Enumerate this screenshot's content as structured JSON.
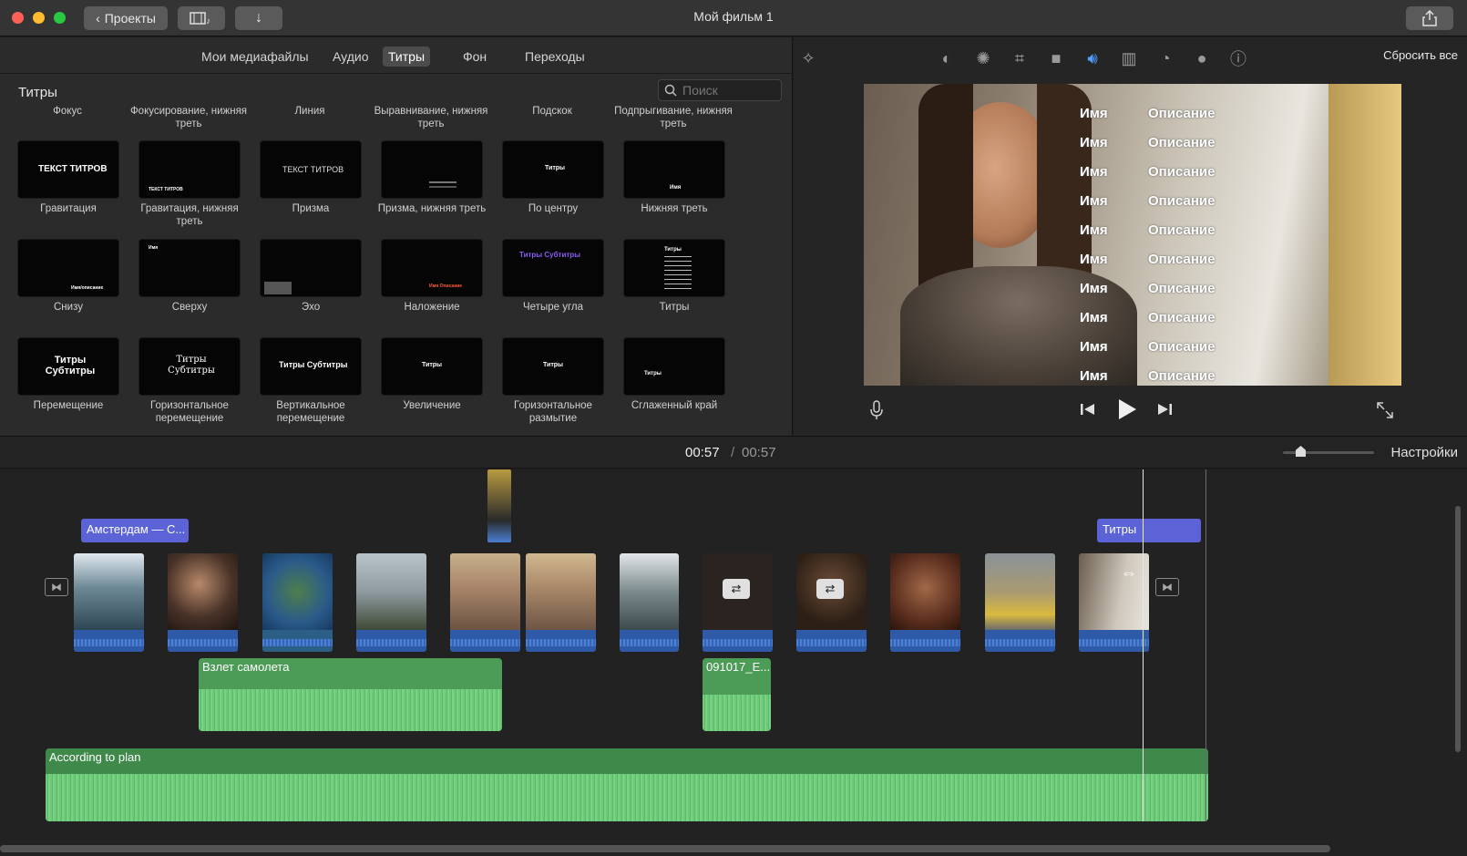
{
  "window": {
    "title": "Мой фильм 1",
    "back_label": "Проекты",
    "traffic_colors": [
      "#fe5f57",
      "#febc2e",
      "#28c840"
    ]
  },
  "browser": {
    "tabs": [
      {
        "label": "Мои медиафайлы",
        "active": false
      },
      {
        "label": "Аудио",
        "active": false
      },
      {
        "label": "Титры",
        "active": true
      },
      {
        "label": "Фон",
        "active": false
      },
      {
        "label": "Переходы",
        "active": false
      }
    ],
    "section_title": "Титры",
    "search_placeholder": "Поиск",
    "cut_labels": [
      "Фокус",
      "Фокусирование, нижняя треть",
      "Линия",
      "Выравнивание, нижняя треть",
      "Подскок",
      "Подпрыгивание, нижняя треть"
    ],
    "rows": [
      [
        {
          "label": "Гравитация",
          "thumb": "ТЕКСТ ТИТРОВ"
        },
        {
          "label": "Гравитация, нижняя треть",
          "thumb": "ТЕКСТ ТИТРОВ"
        },
        {
          "label": "Призма",
          "thumb": "ТЕКСТ ТИТРОВ"
        },
        {
          "label": "Призма, нижняя треть",
          "thumb": ""
        },
        {
          "label": "По центру",
          "thumb": "Титры"
        },
        {
          "label": "Нижняя треть",
          "thumb": "Имя"
        }
      ],
      [
        {
          "label": "Снизу",
          "thumb": "Имя/описание"
        },
        {
          "label": "Сверху",
          "thumb": "Имя"
        },
        {
          "label": "Эхо",
          "thumb": ""
        },
        {
          "label": "Наложение",
          "thumb": "Имя Описание"
        },
        {
          "label": "Четыре угла",
          "thumb": "Титры Субтитры"
        },
        {
          "label": "Титры",
          "thumb": "Титры"
        }
      ],
      [
        {
          "label": "Перемещение",
          "thumb": "Титры Субтитры"
        },
        {
          "label": "Горизонтальное перемещение",
          "thumb": "Титры Субтитры"
        },
        {
          "label": "Вертикальное перемещение",
          "thumb": "Титры Субтитры"
        },
        {
          "label": "Увеличение",
          "thumb": "Титры"
        },
        {
          "label": "Горизонтальное размытие",
          "thumb": "Титры"
        },
        {
          "label": "Сглаженный край",
          "thumb": "Титры"
        }
      ]
    ]
  },
  "viewer": {
    "reset_label": "Сбросить все",
    "overlay_rows": [
      {
        "name": "Имя",
        "desc": "Описание"
      },
      {
        "name": "Имя",
        "desc": "Описание"
      },
      {
        "name": "Имя",
        "desc": "Описание"
      },
      {
        "name": "Имя",
        "desc": "Описание"
      },
      {
        "name": "Имя",
        "desc": "Описание"
      },
      {
        "name": "Имя",
        "desc": "Описание"
      },
      {
        "name": "Имя",
        "desc": "Описание"
      },
      {
        "name": "Имя",
        "desc": "Описание"
      },
      {
        "name": "Имя",
        "desc": "Описание"
      },
      {
        "name": "Имя",
        "desc": "Описание"
      }
    ]
  },
  "timebar": {
    "current": "00:57",
    "separator": "/",
    "total": "00:57",
    "settings_label": "Настройки"
  },
  "timeline": {
    "title_clips": [
      "Амстердам — С...",
      "Титры"
    ],
    "audio_clips": [
      "Взлет самолета",
      "091017_E..."
    ],
    "music": "According to plan"
  }
}
